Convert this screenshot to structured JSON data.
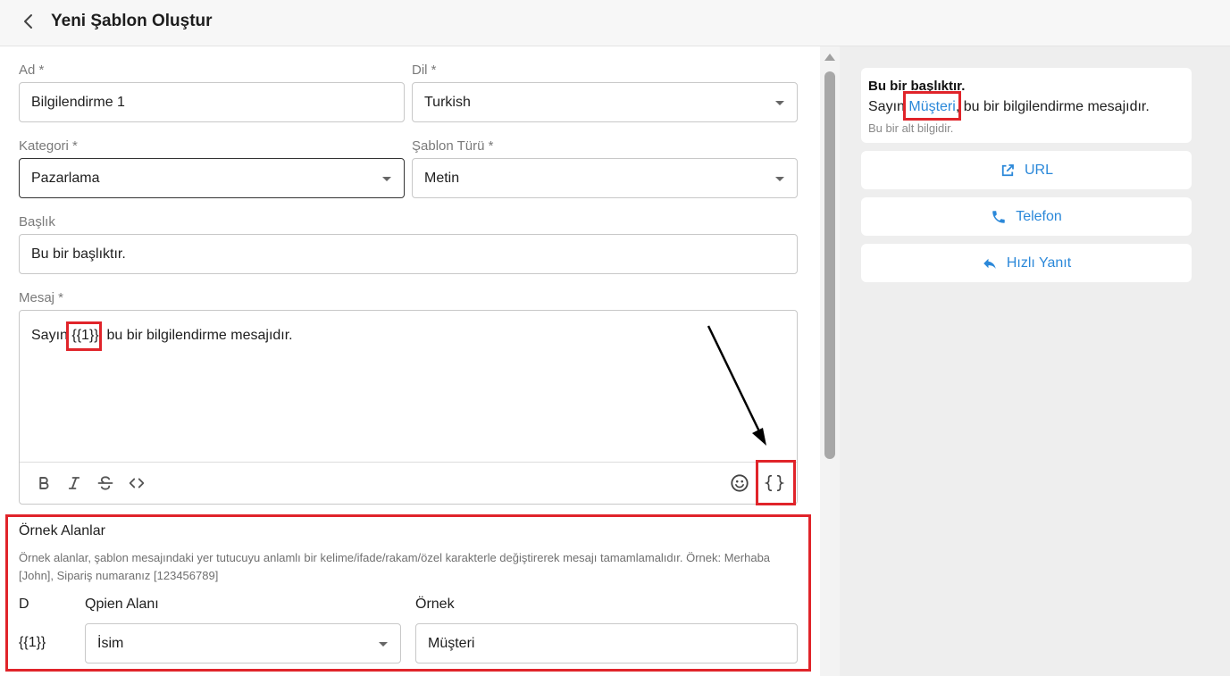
{
  "header": {
    "title": "Yeni Şablon Oluştur"
  },
  "form": {
    "name": {
      "label": "Ad *",
      "value": "Bilgilendirme 1"
    },
    "language": {
      "label": "Dil *",
      "value": "Turkish"
    },
    "category": {
      "label": "Kategori *",
      "value": "Pazarlama"
    },
    "template_type": {
      "label": "Şablon Türü *",
      "value": "Metin"
    },
    "heading": {
      "label": "Başlık",
      "value": "Bu bir başlıktır."
    },
    "message": {
      "label": "Mesaj *",
      "text_before": "Sayın ",
      "variable": "{{1}}",
      "text_after": ", bu bir bilgilendirme mesajıdır."
    }
  },
  "examples": {
    "title": "Örnek Alanlar",
    "description": "Örnek alanlar, şablon mesajındaki yer tutucuyu anlamlı bir kelime/ifade/rakam/özel karakterle değiştirerek mesajı tamamlamalıdır. Örnek: Merhaba [John], Sipariş numaranız [123456789]",
    "columns": [
      "D",
      "Qpien Alanı",
      "Örnek"
    ],
    "rows": [
      {
        "variable": "{{1}}",
        "field": "İsim",
        "example": "Müşteri"
      }
    ]
  },
  "preview": {
    "title": "Bu bir başlıktır.",
    "body_before": "Sayın ",
    "body_var": "Müşteri",
    "body_after": ", bu bir bilgilendirme mesajıdır.",
    "footer": "Bu bir alt bilgidir.",
    "buttons": [
      {
        "label": "URL",
        "icon": "external-link-icon"
      },
      {
        "label": "Telefon",
        "icon": "phone-icon"
      },
      {
        "label": "Hızlı Yanıt",
        "icon": "reply-icon"
      }
    ]
  },
  "colors": {
    "accent": "#2b88d9",
    "highlight": "#e0242a"
  }
}
